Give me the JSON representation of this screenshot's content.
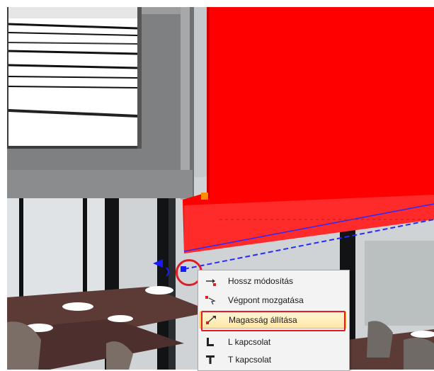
{
  "context_menu": {
    "items": [
      {
        "label": "Hossz módosítás",
        "icon": "length-modify-icon"
      },
      {
        "label": "Végpont mozgatása",
        "icon": "endpoint-move-icon"
      },
      {
        "label": "Magasság állítása",
        "icon": "height-set-icon",
        "highlighted": true
      },
      {
        "label": "L kapcsolat",
        "icon": "l-connection-icon"
      },
      {
        "label": "T kapcsolat",
        "icon": "t-connection-icon"
      }
    ]
  },
  "colors": {
    "selected_wall": "#ff0000",
    "highlight_border": "#e01b24",
    "guide_line": "#1a1aff"
  }
}
